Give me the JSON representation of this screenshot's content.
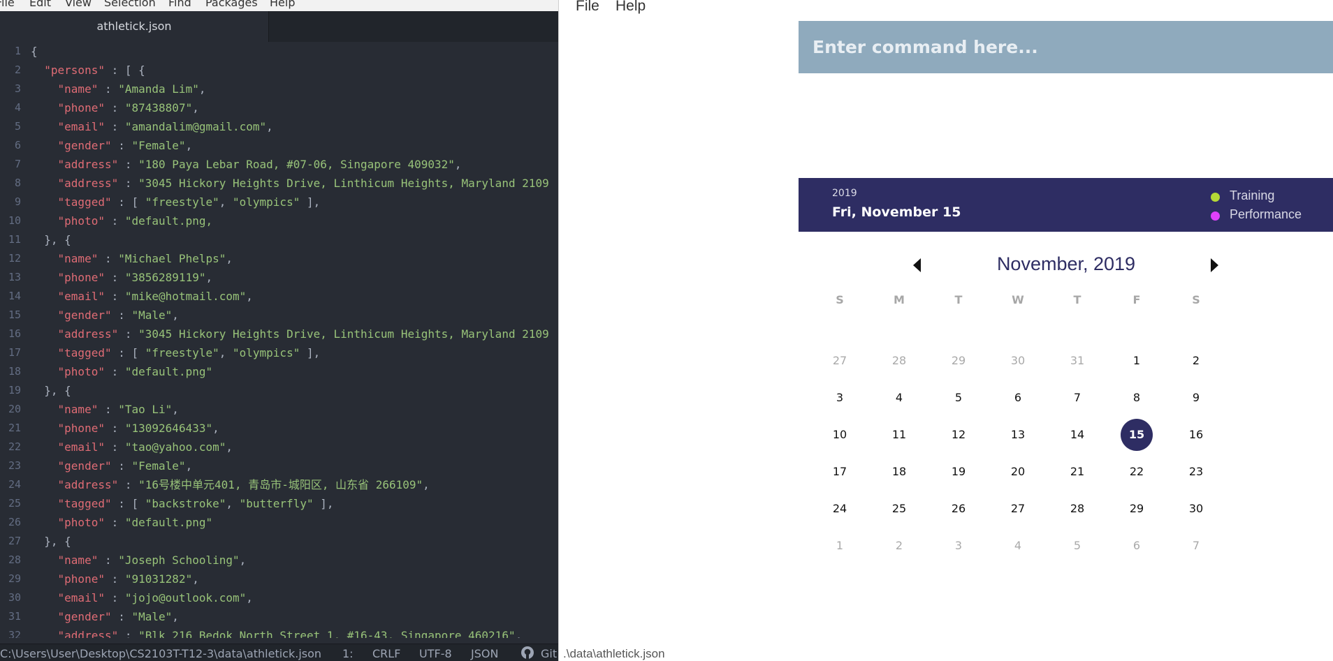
{
  "editor": {
    "menu": [
      "File",
      "Edit",
      "View",
      "Selection",
      "Find",
      "Packages",
      "Help"
    ],
    "tab_title": "athletick.json",
    "lines": [
      [
        [
          "pun",
          "{"
        ]
      ],
      [
        [
          "pun",
          "  "
        ],
        [
          "key",
          "\"persons\""
        ],
        [
          "pun",
          " : [ {"
        ]
      ],
      [
        [
          "pun",
          "    "
        ],
        [
          "key",
          "\"name\""
        ],
        [
          "pun",
          " : "
        ],
        [
          "str",
          "\"Amanda Lim\""
        ],
        [
          "pun",
          ","
        ]
      ],
      [
        [
          "pun",
          "    "
        ],
        [
          "key",
          "\"phone\""
        ],
        [
          "pun",
          " : "
        ],
        [
          "str",
          "\"87438807\""
        ],
        [
          "pun",
          ","
        ]
      ],
      [
        [
          "pun",
          "    "
        ],
        [
          "key",
          "\"email\""
        ],
        [
          "pun",
          " : "
        ],
        [
          "str",
          "\"amandalim@gmail.com\""
        ],
        [
          "pun",
          ","
        ]
      ],
      [
        [
          "pun",
          "    "
        ],
        [
          "key",
          "\"gender\""
        ],
        [
          "pun",
          " : "
        ],
        [
          "str",
          "\"Female\""
        ],
        [
          "pun",
          ","
        ]
      ],
      [
        [
          "pun",
          "    "
        ],
        [
          "key",
          "\"address\""
        ],
        [
          "pun",
          " : "
        ],
        [
          "str",
          "\"180 Paya Lebar Road, #07-06, Singapore 409032\""
        ],
        [
          "pun",
          ","
        ]
      ],
      [
        [
          "pun",
          "    "
        ],
        [
          "key",
          "\"address\""
        ],
        [
          "pun",
          " : "
        ],
        [
          "str",
          "\"3045 Hickory Heights Drive, Linthicum Heights, Maryland 2109"
        ]
      ],
      [
        [
          "pun",
          "    "
        ],
        [
          "key",
          "\"tagged\""
        ],
        [
          "pun",
          " : [ "
        ],
        [
          "str",
          "\"freestyle\""
        ],
        [
          "pun",
          ", "
        ],
        [
          "str",
          "\"olympics\""
        ],
        [
          "pun",
          " ],"
        ]
      ],
      [
        [
          "pun",
          "    "
        ],
        [
          "key",
          "\"photo\""
        ],
        [
          "pun",
          " : "
        ],
        [
          "str",
          "\"default.png,"
        ]
      ],
      [
        [
          "pun",
          "  }, {"
        ]
      ],
      [
        [
          "pun",
          "    "
        ],
        [
          "key",
          "\"name\""
        ],
        [
          "pun",
          " : "
        ],
        [
          "str",
          "\"Michael Phelps\""
        ],
        [
          "pun",
          ","
        ]
      ],
      [
        [
          "pun",
          "    "
        ],
        [
          "key",
          "\"phone\""
        ],
        [
          "pun",
          " : "
        ],
        [
          "str",
          "\"3856289119\""
        ],
        [
          "pun",
          ","
        ]
      ],
      [
        [
          "pun",
          "    "
        ],
        [
          "key",
          "\"email\""
        ],
        [
          "pun",
          " : "
        ],
        [
          "str",
          "\"mike@hotmail.com\""
        ],
        [
          "pun",
          ","
        ]
      ],
      [
        [
          "pun",
          "    "
        ],
        [
          "key",
          "\"gender\""
        ],
        [
          "pun",
          " : "
        ],
        [
          "str",
          "\"Male\""
        ],
        [
          "pun",
          ","
        ]
      ],
      [
        [
          "pun",
          "    "
        ],
        [
          "key",
          "\"address\""
        ],
        [
          "pun",
          " : "
        ],
        [
          "str",
          "\"3045 Hickory Heights Drive, Linthicum Heights, Maryland 2109"
        ]
      ],
      [
        [
          "pun",
          "    "
        ],
        [
          "key",
          "\"tagged\""
        ],
        [
          "pun",
          " : [ "
        ],
        [
          "str",
          "\"freestyle\""
        ],
        [
          "pun",
          ", "
        ],
        [
          "str",
          "\"olympics\""
        ],
        [
          "pun",
          " ],"
        ]
      ],
      [
        [
          "pun",
          "    "
        ],
        [
          "key",
          "\"photo\""
        ],
        [
          "pun",
          " : "
        ],
        [
          "str",
          "\"default.png\""
        ]
      ],
      [
        [
          "pun",
          "  }, {"
        ]
      ],
      [
        [
          "pun",
          "    "
        ],
        [
          "key",
          "\"name\""
        ],
        [
          "pun",
          " : "
        ],
        [
          "str",
          "\"Tao Li\""
        ],
        [
          "pun",
          ","
        ]
      ],
      [
        [
          "pun",
          "    "
        ],
        [
          "key",
          "\"phone\""
        ],
        [
          "pun",
          " : "
        ],
        [
          "str",
          "\"13092646433\""
        ],
        [
          "pun",
          ","
        ]
      ],
      [
        [
          "pun",
          "    "
        ],
        [
          "key",
          "\"email\""
        ],
        [
          "pun",
          " : "
        ],
        [
          "str",
          "\"tao@yahoo.com\""
        ],
        [
          "pun",
          ","
        ]
      ],
      [
        [
          "pun",
          "    "
        ],
        [
          "key",
          "\"gender\""
        ],
        [
          "pun",
          " : "
        ],
        [
          "str",
          "\"Female\""
        ],
        [
          "pun",
          ","
        ]
      ],
      [
        [
          "pun",
          "    "
        ],
        [
          "key",
          "\"address\""
        ],
        [
          "pun",
          " : "
        ],
        [
          "str",
          "\"16号楼中单元401, 青岛市-城阳区, 山东省 266109\""
        ],
        [
          "pun",
          ","
        ]
      ],
      [
        [
          "pun",
          "    "
        ],
        [
          "key",
          "\"tagged\""
        ],
        [
          "pun",
          " : [ "
        ],
        [
          "str",
          "\"backstroke\""
        ],
        [
          "pun",
          ", "
        ],
        [
          "str",
          "\"butterfly\""
        ],
        [
          "pun",
          " ],"
        ]
      ],
      [
        [
          "pun",
          "    "
        ],
        [
          "key",
          "\"photo\""
        ],
        [
          "pun",
          " : "
        ],
        [
          "str",
          "\"default.png\""
        ]
      ],
      [
        [
          "pun",
          "  }, {"
        ]
      ],
      [
        [
          "pun",
          "    "
        ],
        [
          "key",
          "\"name\""
        ],
        [
          "pun",
          " : "
        ],
        [
          "str",
          "\"Joseph Schooling\""
        ],
        [
          "pun",
          ","
        ]
      ],
      [
        [
          "pun",
          "    "
        ],
        [
          "key",
          "\"phone\""
        ],
        [
          "pun",
          " : "
        ],
        [
          "str",
          "\"91031282\""
        ],
        [
          "pun",
          ","
        ]
      ],
      [
        [
          "pun",
          "    "
        ],
        [
          "key",
          "\"email\""
        ],
        [
          "pun",
          " : "
        ],
        [
          "str",
          "\"jojo@outlook.com\""
        ],
        [
          "pun",
          ","
        ]
      ],
      [
        [
          "pun",
          "    "
        ],
        [
          "key",
          "\"gender\""
        ],
        [
          "pun",
          " : "
        ],
        [
          "str",
          "\"Male\""
        ],
        [
          "pun",
          ","
        ]
      ],
      [
        [
          "pun",
          "    "
        ],
        [
          "key",
          "\"address\""
        ],
        [
          "pun",
          " : "
        ],
        [
          "str",
          "\"Blk 216 Bedok North Street 1, #16-43, Singapore 460216\""
        ],
        [
          "pun",
          ","
        ]
      ]
    ],
    "status": {
      "path": "C:\\Users\\User\\Desktop\\CS2103T-T12-3\\data\\athletick.json",
      "cursor": "1:",
      "line_ending": "CRLF",
      "encoding": "UTF-8",
      "grammar": "JSON",
      "git": "Git"
    }
  },
  "app": {
    "menu": [
      "File",
      "Help"
    ],
    "command_placeholder": "Enter command here...",
    "calendar_header": {
      "year": "2019",
      "date": "Fri, November 15"
    },
    "legend": [
      {
        "label": "Training",
        "color": "#b5d936"
      },
      {
        "label": "Performance",
        "color": "#e040fb"
      }
    ],
    "month_title": "November, 2019",
    "weekdays": [
      "S",
      "M",
      "T",
      "W",
      "T",
      "F",
      "S"
    ],
    "weeks": [
      [
        {
          "d": "27",
          "muted": true
        },
        {
          "d": "28",
          "muted": true
        },
        {
          "d": "29",
          "muted": true
        },
        {
          "d": "30",
          "muted": true
        },
        {
          "d": "31",
          "muted": true
        },
        {
          "d": "1"
        },
        {
          "d": "2"
        }
      ],
      [
        {
          "d": "3"
        },
        {
          "d": "4"
        },
        {
          "d": "5"
        },
        {
          "d": "6"
        },
        {
          "d": "7"
        },
        {
          "d": "8"
        },
        {
          "d": "9"
        }
      ],
      [
        {
          "d": "10"
        },
        {
          "d": "11"
        },
        {
          "d": "12"
        },
        {
          "d": "13"
        },
        {
          "d": "14"
        },
        {
          "d": "15",
          "selected": true
        },
        {
          "d": "16"
        }
      ],
      [
        {
          "d": "17"
        },
        {
          "d": "18"
        },
        {
          "d": "19"
        },
        {
          "d": "20"
        },
        {
          "d": "21"
        },
        {
          "d": "22"
        },
        {
          "d": "23"
        }
      ],
      [
        {
          "d": "24"
        },
        {
          "d": "25"
        },
        {
          "d": "26"
        },
        {
          "d": "27"
        },
        {
          "d": "28"
        },
        {
          "d": "29"
        },
        {
          "d": "30"
        }
      ],
      [
        {
          "d": "1",
          "muted": true
        },
        {
          "d": "2",
          "muted": true
        },
        {
          "d": "3",
          "muted": true
        },
        {
          "d": "4",
          "muted": true
        },
        {
          "d": "5",
          "muted": true
        },
        {
          "d": "6",
          "muted": true
        },
        {
          "d": "7",
          "muted": true
        }
      ]
    ],
    "status_path": ".\\data\\athletick.json"
  }
}
